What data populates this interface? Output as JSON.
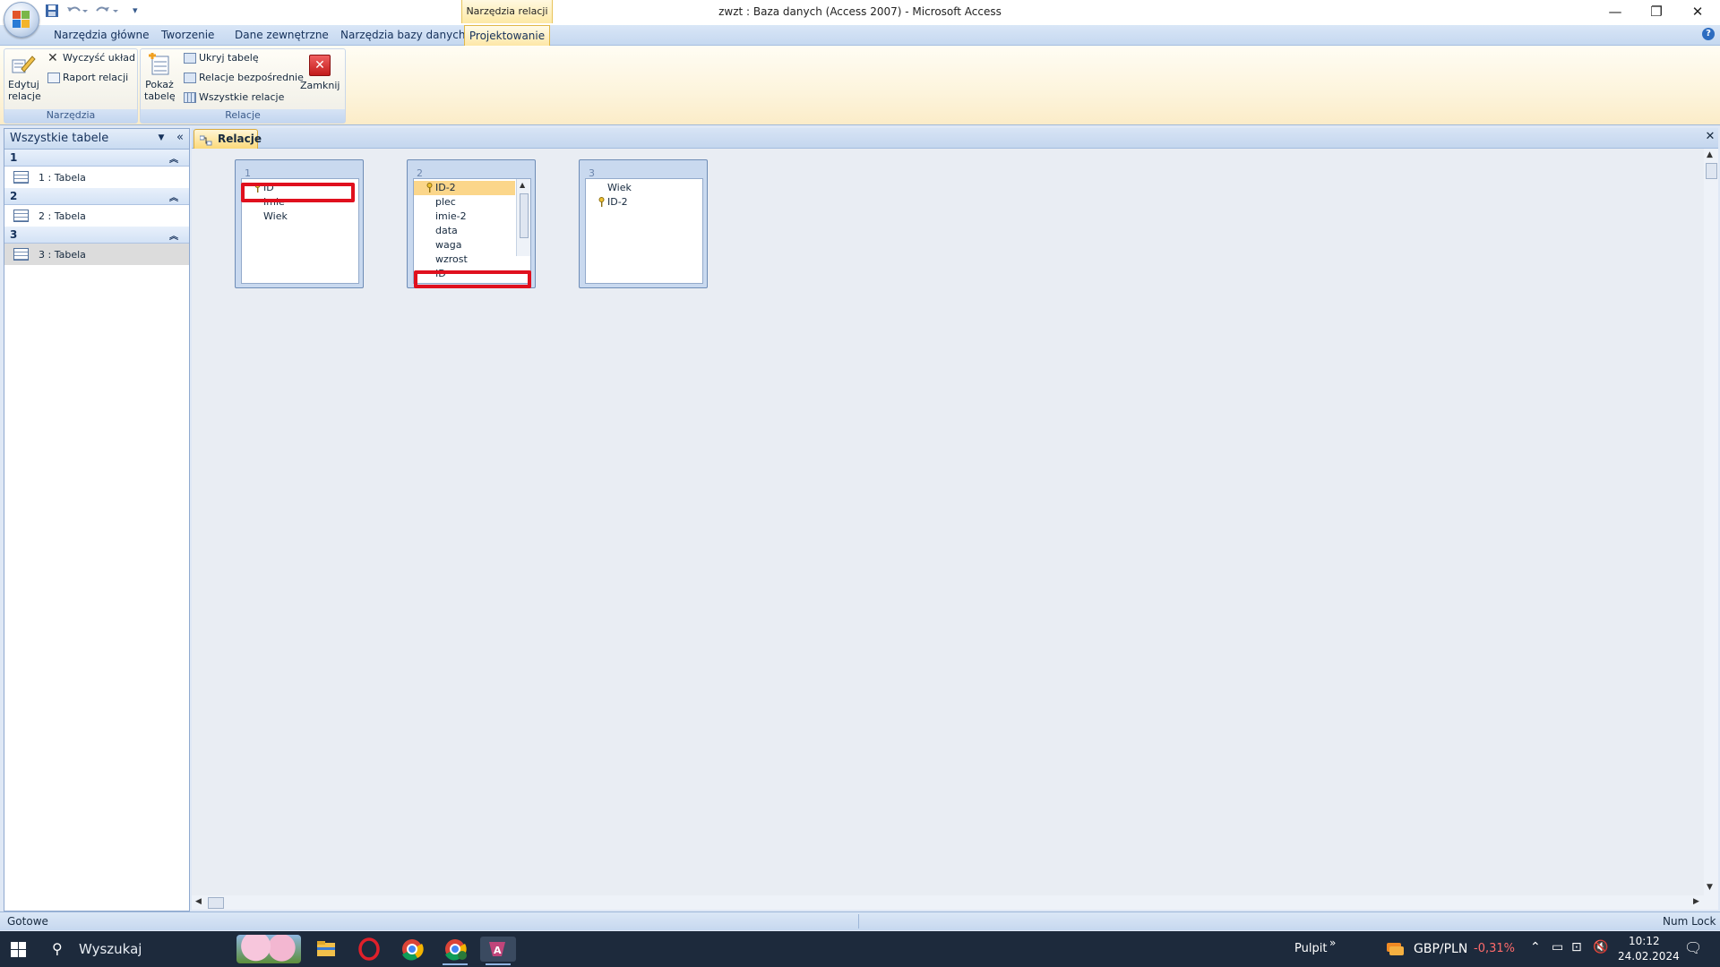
{
  "window": {
    "title": "zwzt : Baza danych (Access 2007) - Microsoft Access",
    "contextual_tab_label": "Narzędzia relacji",
    "controls": {
      "minimize": "—",
      "restore": "❐",
      "close": "✕"
    }
  },
  "qat": {
    "customize": "▾"
  },
  "ribbon": {
    "tabs": [
      "Narzędzia główne",
      "Tworzenie",
      "Dane zewnętrzne",
      "Narzędzia bazy danych"
    ],
    "active_tab": "Projektowanie",
    "groups": {
      "narzedzia": {
        "label": "Narzędzia",
        "edit_relations": {
          "line1": "Edytuj",
          "line2": "relacje"
        },
        "clear_layout": "Wyczyść układ",
        "relation_report": "Raport relacji"
      },
      "relacje": {
        "label": "Relacje",
        "show_table": {
          "line1": "Pokaż",
          "line2": "tabelę"
        },
        "hide_table": "Ukryj tabelę",
        "direct_relations": "Relacje bezpośrednie",
        "all_relations": "Wszystkie relacje",
        "close": "Zamknij"
      }
    },
    "help": "?"
  },
  "nav_pane": {
    "title": "Wszystkie tabele",
    "collapse": "«",
    "groups": [
      {
        "label": "1",
        "item": "1 : Tabela",
        "selected": false
      },
      {
        "label": "2",
        "item": "2 : Tabela",
        "selected": false
      },
      {
        "label": "3",
        "item": "3 : Tabela",
        "selected": true
      }
    ]
  },
  "document": {
    "tab_label": "Relacje",
    "close": "✕",
    "tables": [
      {
        "title": "1",
        "fields": [
          {
            "name": "ID",
            "key": true
          },
          {
            "name": "Imie",
            "key": false
          },
          {
            "name": "Wiek",
            "key": false
          }
        ]
      },
      {
        "title": "2",
        "fields": [
          {
            "name": "ID-2",
            "key": true,
            "highlight": true
          },
          {
            "name": "plec",
            "key": false
          },
          {
            "name": "imie-2",
            "key": false
          },
          {
            "name": "data",
            "key": false
          },
          {
            "name": "waga",
            "key": false
          },
          {
            "name": "wzrost",
            "key": false
          },
          {
            "name": "ID",
            "key": false
          }
        ]
      },
      {
        "title": "3",
        "fields": [
          {
            "name": "Wiek",
            "key": false
          },
          {
            "name": "ID-2",
            "key": true
          }
        ]
      }
    ]
  },
  "status_bar": {
    "left": "Gotowe",
    "right": "Num Lock"
  },
  "taskbar": {
    "search_placeholder": "Wyszukaj",
    "desktop_label": "Pulpit",
    "desktop_chevron": "»",
    "currency_pair": "GBP/PLN",
    "currency_change": "-0,31%",
    "time": "10:12",
    "date": "24.02.2024"
  },
  "colors": {
    "accent_red": "#e0101e",
    "change_negative": "#ff6b6b",
    "taskbar_bg": "#1d2a3c"
  }
}
